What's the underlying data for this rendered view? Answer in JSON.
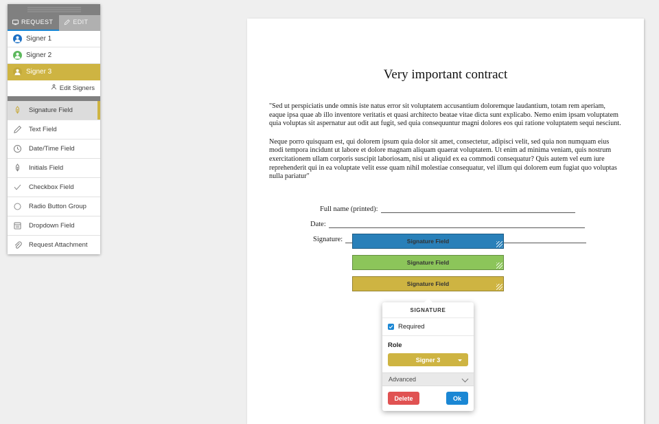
{
  "panel": {
    "tabs": [
      {
        "label": "REQUEST",
        "icon": "monitor-icon",
        "active": true
      },
      {
        "label": "EDIT",
        "icon": "pencil-icon",
        "active": false
      }
    ],
    "signers": [
      {
        "label": "Signer 1",
        "color": "#1b6fc4",
        "selected": false
      },
      {
        "label": "Signer 2",
        "color": "#5cb85c",
        "selected": false
      },
      {
        "label": "Signer 3",
        "color": "#ceb442",
        "selected": true
      }
    ],
    "edit_signers_label": "Edit Signers",
    "fields": [
      {
        "label": "Signature Field",
        "icon": "pen-nib-icon",
        "selected": true
      },
      {
        "label": "Text Field",
        "icon": "pencil-icon",
        "selected": false
      },
      {
        "label": "Date/Time Field",
        "icon": "clock-icon",
        "selected": false
      },
      {
        "label": "Initials Field",
        "icon": "pen-nib-icon",
        "selected": false
      },
      {
        "label": "Checkbox Field",
        "icon": "check-icon",
        "selected": false
      },
      {
        "label": "Radio Button Group",
        "icon": "circle-icon",
        "selected": false
      },
      {
        "label": "Dropdown Field",
        "icon": "dropdown-icon",
        "selected": false
      },
      {
        "label": "Request Attachment",
        "icon": "paperclip-icon",
        "selected": false
      }
    ]
  },
  "document": {
    "title": "Very important contract",
    "paragraph1": "\"Sed ut perspiciatis unde omnis iste natus error sit voluptatem accusantium doloremque laudantium, totam rem aperiam, eaque ipsa quae ab illo inventore veritatis et quasi architecto beatae vitae dicta sunt explicabo. Nemo enim ipsam voluptatem quia voluptas sit aspernatur aut odit aut fugit, sed quia consequuntur magni dolores eos qui ratione voluptatem sequi nesciunt.",
    "paragraph2": "Neque porro quisquam est, qui dolorem ipsum quia dolor sit amet, consectetur, adipisci velit, sed quia non numquam eius modi tempora incidunt ut labore et dolore magnam aliquam quaerat voluptatem. Ut enim ad minima veniam, quis nostrum exercitationem ullam corporis suscipit laboriosam, nisi ut aliquid ex ea commodi consequatur? Quis autem vel eum iure reprehenderit qui in ea voluptate velit esse quam nihil molestiae consequatur, vel illum qui dolorem eum fugiat quo voluptas nulla pariatur\"",
    "form_labels": {
      "full_name": "Full name (printed):",
      "date": "Date:",
      "signature": "Signature:"
    },
    "signature_fields": [
      {
        "label": "Signature Field",
        "color": "#2980b9"
      },
      {
        "label": "Signature Field",
        "color": "#8cc55a"
      },
      {
        "label": "Signature Field",
        "color": "#ceb442"
      }
    ]
  },
  "popup": {
    "title": "SIGNATURE",
    "required_label": "Required",
    "required_checked": true,
    "role_label": "Role",
    "role_value": "Signer 3",
    "role_color": "#ceb442",
    "advanced_label": "Advanced",
    "delete_label": "Delete",
    "ok_label": "Ok",
    "delete_color": "#e05252",
    "ok_color": "#1b87d4"
  }
}
